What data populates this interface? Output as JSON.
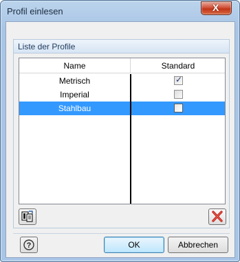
{
  "window": {
    "title": "Profil einlesen",
    "close_glyph": "X"
  },
  "group": {
    "title": "Liste der Profile"
  },
  "table": {
    "columns": [
      "Name",
      "Standard"
    ],
    "rows": [
      {
        "name": "Metrisch",
        "standard": true,
        "selected": false
      },
      {
        "name": "Imperial",
        "standard": false,
        "selected": false
      },
      {
        "name": "Stahlbau",
        "standard": false,
        "selected": true
      }
    ]
  },
  "toolbar": {
    "import_icon": "import-profile-icon",
    "delete_icon": "delete-icon"
  },
  "buttons": {
    "help_icon": "help-icon",
    "ok": "OK",
    "cancel": "Abbrechen"
  },
  "colors": {
    "selection": "#3399ff",
    "delete_red": "#c0251c"
  }
}
